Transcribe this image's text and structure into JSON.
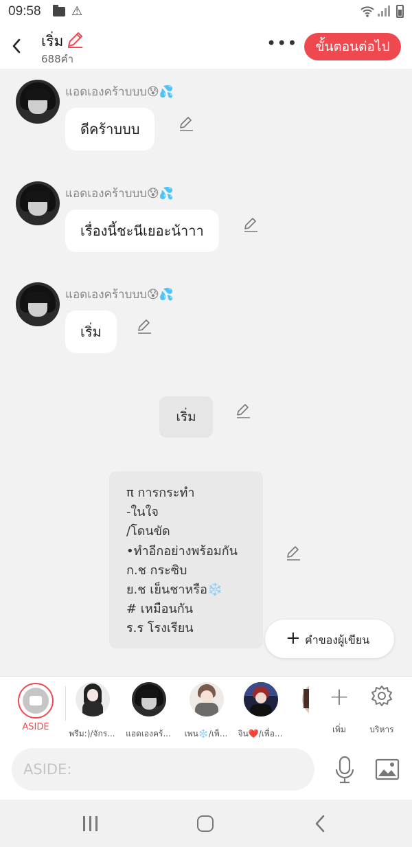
{
  "status_bar": {
    "time": "09:58"
  },
  "header": {
    "title": "เริ่ม",
    "word_count": "688คำ",
    "more": "•••",
    "next_button": "ขั้นตอนต่อไป"
  },
  "messages": [
    {
      "sender": "แอดเองคร้าบบบ",
      "sender_emoji": "😰💦",
      "text": "ดีคร้าบบบ"
    },
    {
      "sender": "แอดเองคร้าบบบ",
      "sender_emoji": "😰💦",
      "text": "เรื่องนี้ชะนีเยอะน้าาา"
    },
    {
      "sender": "แอดเองคร้าบบบ",
      "sender_emoji": "😰💦",
      "text": "เริ่ม"
    }
  ],
  "narration": {
    "text": "เริ่ม"
  },
  "note": {
    "lines": [
      "π การกระทำ",
      "-ในใจ",
      "/โดนขัด",
      "•ทำอีกอย่างพร้อมกัน",
      "ก.ช กระซิบ",
      "ย.ช เย็นชาหรือ❄️",
      "# เหมือนกัน",
      "ร.ร โรงเรียน"
    ]
  },
  "author_button": {
    "plus": "+",
    "label": "คำของผู้เขียน"
  },
  "character_bar": {
    "aside_label": "ASIDE",
    "characters": [
      {
        "label": "พรีม:)/จักร..."
      },
      {
        "label": "แอดเองคร้..."
      },
      {
        "label": "เพน❄️/เพ็..."
      },
      {
        "label": "จิน❤️/เพื่อ..."
      }
    ],
    "add_label": "เพิ่ม",
    "manage_label": "บริหาร"
  },
  "input": {
    "placeholder": "ASIDE:"
  },
  "colors": {
    "accent": "#f0484f",
    "background": "#f2f2f2",
    "bubble": "#ffffff"
  }
}
